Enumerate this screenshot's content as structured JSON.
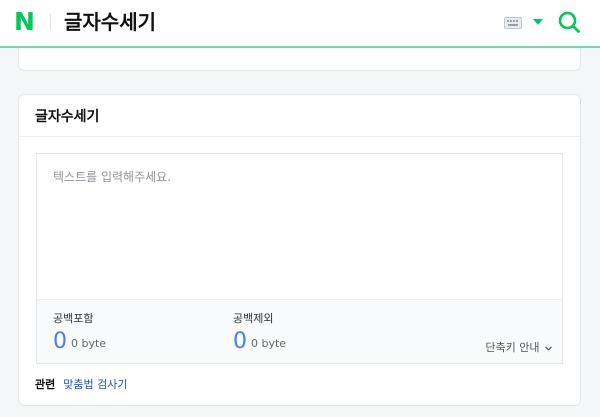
{
  "header": {
    "logo": "N",
    "title": "글자수세기",
    "keyboard_icon": "keyboard-icon",
    "dropdown_icon": "dropdown-arrow-icon",
    "search_icon": "search-icon",
    "accent_color": "#03c75a"
  },
  "card": {
    "title": "글자수세기",
    "editor": {
      "placeholder": "텍스트를 입력해주세요.",
      "value": ""
    },
    "stats": [
      {
        "label": "공백포함",
        "count": "0",
        "bytes": "0 byte"
      },
      {
        "label": "공백제외",
        "count": "0",
        "bytes": "0 byte"
      }
    ],
    "shortcut_label": "단축키 안내",
    "related": {
      "label": "관련",
      "link": "맞춤법 검사기"
    },
    "value_color": "#4a7cf7",
    "link_color": "#1a55c7"
  }
}
